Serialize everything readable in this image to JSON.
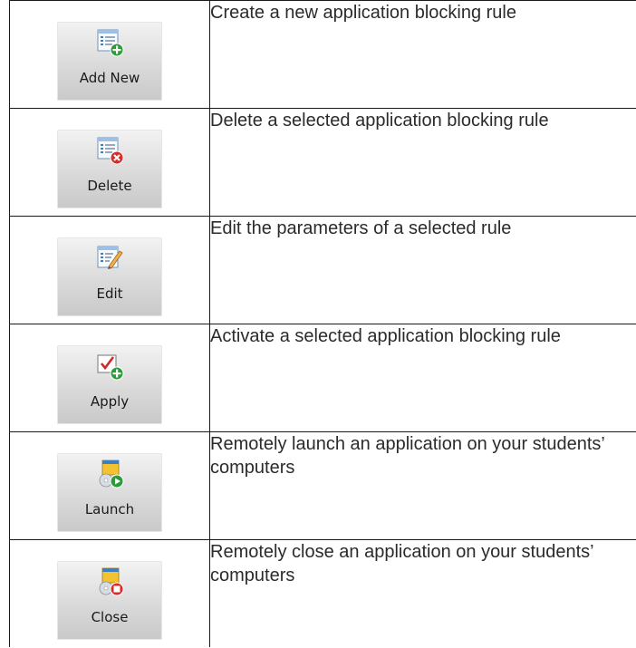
{
  "rows": [
    {
      "button_label": "Add New",
      "icon": "list-add-icon",
      "description": "Create a new application blocking rule"
    },
    {
      "button_label": "Delete",
      "icon": "list-delete-icon",
      "description": "Delete a selected application blocking rule"
    },
    {
      "button_label": "Edit",
      "icon": "list-edit-icon",
      "description": "Edit the parameters of a selected rule"
    },
    {
      "button_label": "Apply",
      "icon": "checkbox-apply-icon",
      "description": "Activate a selected application blocking rule"
    },
    {
      "button_label": "Launch",
      "icon": "app-launch-icon",
      "description": "Remotely launch an application on your students’ computers"
    },
    {
      "button_label": "Close",
      "icon": "app-close-icon",
      "description": "Remotely close an application on your students’ computers"
    }
  ],
  "colors": {
    "button_bg_top": "#f3f3f3",
    "button_bg_bottom": "#c9c9c9",
    "list_blue": "#3a7fc4",
    "add_green": "#2e9b3a",
    "delete_red": "#d92b2b",
    "check_red": "#cc2a2a",
    "app_yellow": "#f2c230"
  }
}
